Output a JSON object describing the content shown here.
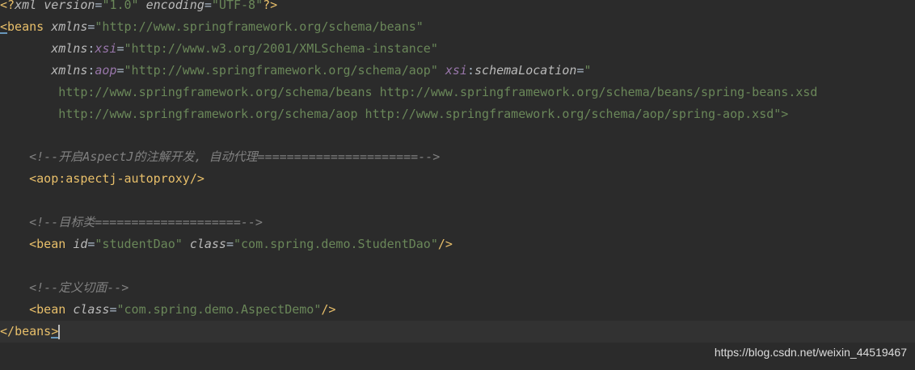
{
  "lines": {
    "l1": {
      "open": "<?",
      "tag": "xml",
      "attr1": "version",
      "eq1": "=",
      "val1": "\"1.0\"",
      "attr2": "encoding",
      "eq2": "=",
      "val2": "\"UTF-8\"",
      "close": "?>"
    },
    "l2": {
      "lt": "<",
      "tag": "beans",
      "attr": "xmlns",
      "eq": "=",
      "val": "\"http://www.springframework.org/schema/beans\""
    },
    "l3": {
      "prefix": "xmlns",
      "colon": ":",
      "name": "xsi",
      "eq": "=",
      "val": "\"http://www.w3.org/2001/XMLSchema-instance\""
    },
    "l4": {
      "prefix": "xmlns",
      "colon": ":",
      "name": "aop",
      "eq": "=",
      "val": "\"http://www.springframework.org/schema/aop\"",
      "attr2_ns": "xsi",
      "attr2_colon": ":",
      "attr2_name": "schemaLocation",
      "eq2": "=",
      "quote": "\""
    },
    "l5": {
      "text": "http://www.springframework.org/schema/beans http://www.springframework.org/schema/beans/spring-beans.xsd"
    },
    "l6": {
      "text": "http://www.springframework.org/schema/aop http://www.springframework.org/schema/aop/spring-aop.xsd",
      "end": "\">"
    },
    "l8": {
      "comment": "<!--开启AspectJ的注解开发, 自动代理======================-->"
    },
    "l9": {
      "lt": "<",
      "tag": "aop:aspectj-autoproxy",
      "close": "/>"
    },
    "l11": {
      "comment": "<!--目标类====================-->"
    },
    "l12": {
      "lt": "<",
      "tag": "bean",
      "attr1": "id",
      "eq1": "=",
      "val1": "\"studentDao\"",
      "attr2": "class",
      "eq2": "=",
      "val2": "\"com.spring.demo.StudentDao\"",
      "close": "/>"
    },
    "l14": {
      "comment": "<!--定义切面-->"
    },
    "l15": {
      "lt": "<",
      "tag": "bean",
      "attr": "class",
      "eq": "=",
      "val": "\"com.spring.demo.AspectDemo\"",
      "close": "/>"
    },
    "l16": {
      "lt": "</",
      "tag": "beans",
      "gt": ">"
    }
  },
  "watermark": "https://blog.csdn.net/weixin_44519467",
  "colors": {
    "background": "#2b2b2b",
    "tag": "#e8bf6a",
    "string": "#6a8759",
    "comment": "#808080",
    "namespace": "#9876aa"
  }
}
